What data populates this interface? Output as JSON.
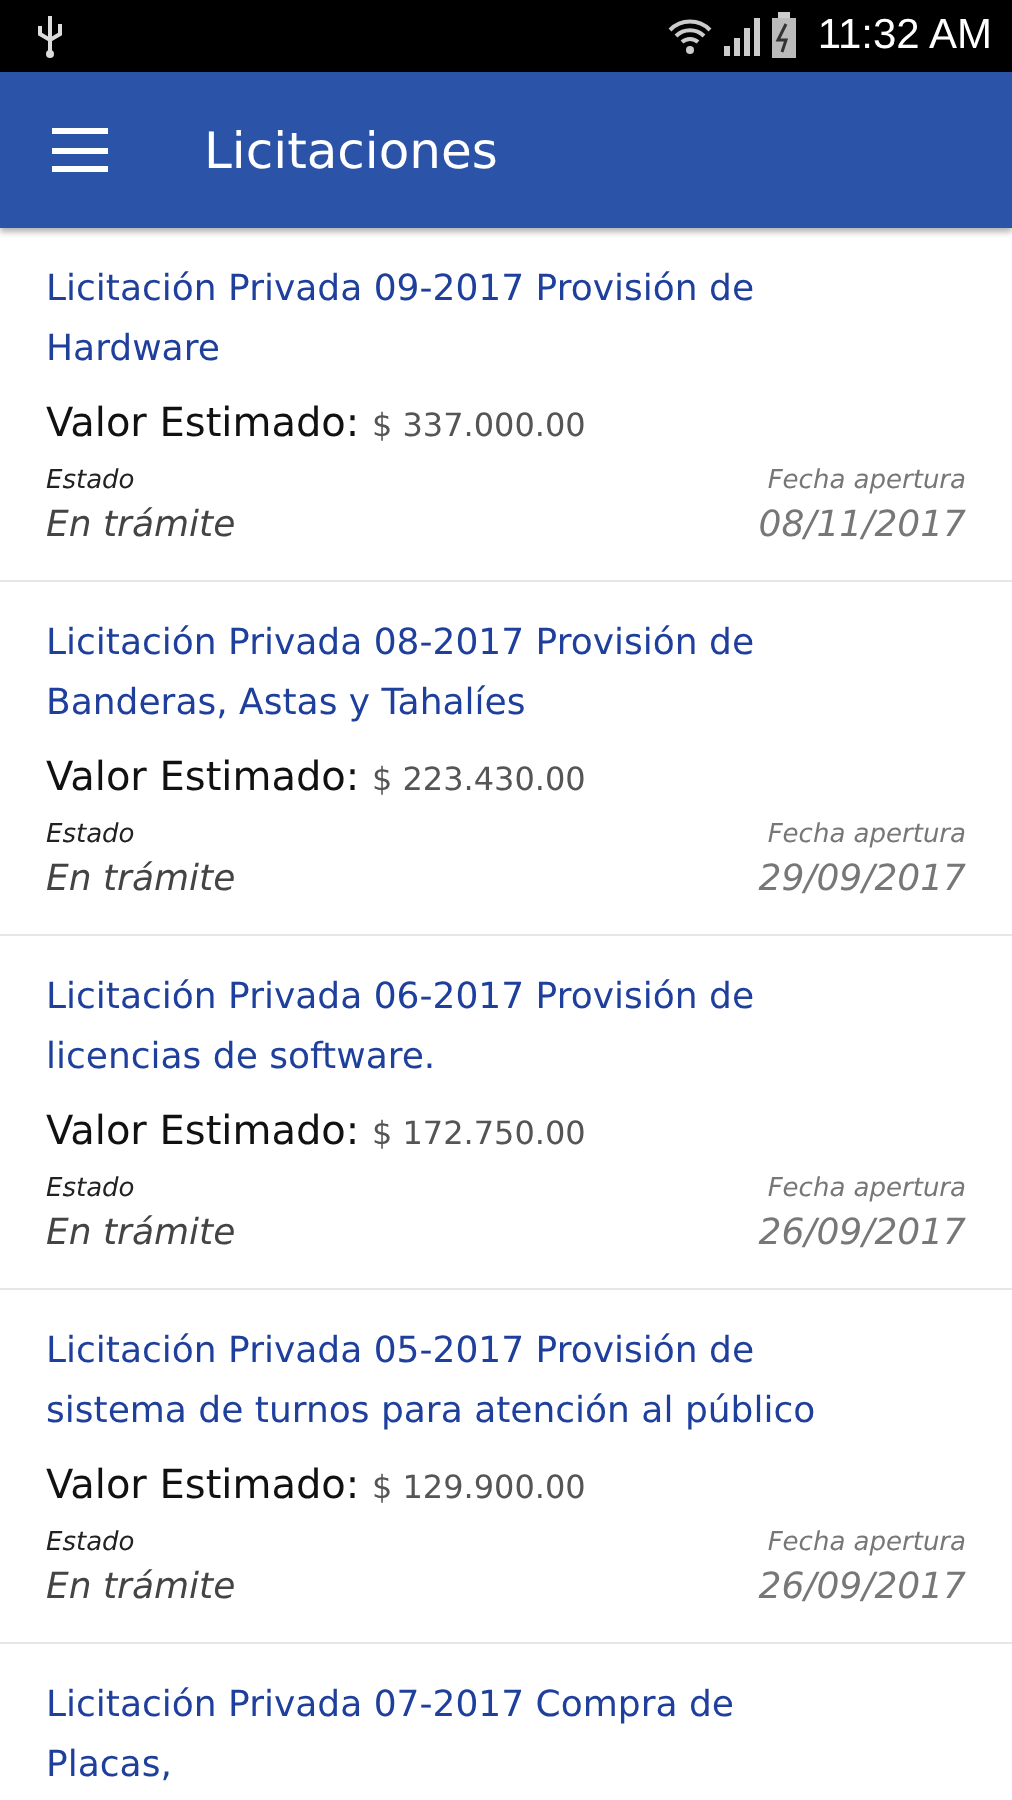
{
  "status_bar": {
    "time": "11:32 AM"
  },
  "app_bar": {
    "title": "Licitaciones"
  },
  "items": [
    {
      "title": "Licitación Privada 09-2017 Provisión de Hardware",
      "value_label": "Valor Estimado:",
      "value": "$ 337.000.00",
      "status_label": "Estado",
      "status": "En trámite",
      "date_label": "Fecha apertura",
      "date": "08/11/2017"
    },
    {
      "title": "Licitación Privada 08-2017 Provisión de Banderas, Astas y Tahalíes",
      "value_label": "Valor Estimado:",
      "value": "$ 223.430.00",
      "status_label": "Estado",
      "status": "En trámite",
      "date_label": "Fecha apertura",
      "date": "29/09/2017"
    },
    {
      "title": "Licitación Privada 06-2017 Provisión de licencias de software.",
      "value_label": "Valor Estimado:",
      "value": "$ 172.750.00",
      "status_label": "Estado",
      "status": "En trámite",
      "date_label": "Fecha apertura",
      "date": "26/09/2017"
    },
    {
      "title": "Licitación Privada 05-2017 Provisión de sistema de turnos para atención al público",
      "value_label": "Valor Estimado:",
      "value": "$ 129.900.00",
      "status_label": "Estado",
      "status": "En trámite",
      "date_label": "Fecha apertura",
      "date": "26/09/2017"
    },
    {
      "title": "Licitación Privada 07-2017 Compra de Placas,"
    }
  ]
}
